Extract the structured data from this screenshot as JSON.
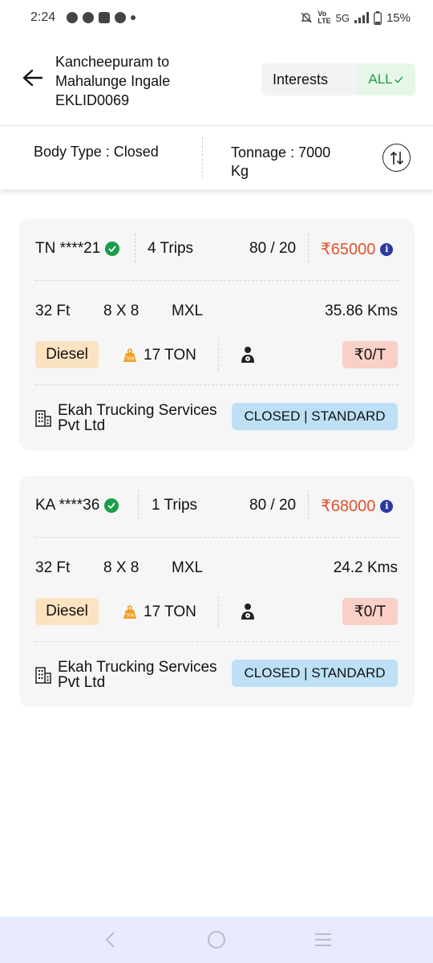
{
  "status_bar": {
    "time": "2:24",
    "network": "5G",
    "battery": "15%",
    "icons": [
      "chat-bubble-icon",
      "location-icon",
      "mail-icon",
      "circle-icon",
      "dot-icon",
      "mute-icon",
      "volte-icon",
      "signal-icon",
      "battery-icon"
    ]
  },
  "header": {
    "route_line1": "Kancheepuram to",
    "route_line2": "Mahalunge Ingale",
    "route_line3": "EKLID0069",
    "interests_label": "Interests",
    "filter_value": "ALL",
    "filter_accent": "#1f9d3a"
  },
  "filters": {
    "body_type": "Body Type : Closed",
    "tonnage_line1": "Tonnage : 7000",
    "tonnage_line2": "Kg"
  },
  "cards": [
    {
      "plate": "TN ****21",
      "trips": "4 Trips",
      "ratio": "80 / 20",
      "price": "₹65000",
      "length": "32 Ft",
      "size": "8 X 8",
      "axle": "MXL",
      "distance": "35.86 Kms",
      "fuel": "Diesel",
      "weight": "17 TON",
      "rate": "₹0/T",
      "company_line1": "Ekah Trucking Services",
      "company_line2": "Pvt Ltd",
      "status": "CLOSED | STANDARD"
    },
    {
      "plate": "KA ****36",
      "trips": "1 Trips",
      "ratio": "80 / 20",
      "price": "₹68000",
      "length": "32 Ft",
      "size": "8 X 8",
      "axle": "MXL",
      "distance": "24.2 Kms",
      "fuel": "Diesel",
      "weight": "17 TON",
      "rate": "₹0/T",
      "company_line1": "Ekah Trucking Services",
      "company_line2": "Pvt Ltd",
      "status": "CLOSED | STANDARD"
    }
  ],
  "colors": {
    "price": "#e0542e",
    "verified": "#1a9e4a",
    "fuel_chip": "#fbe3c2",
    "rate_chip": "#f8d0c7",
    "status_chip": "#bde0f6",
    "nav_bar": "#e8ebfb"
  }
}
